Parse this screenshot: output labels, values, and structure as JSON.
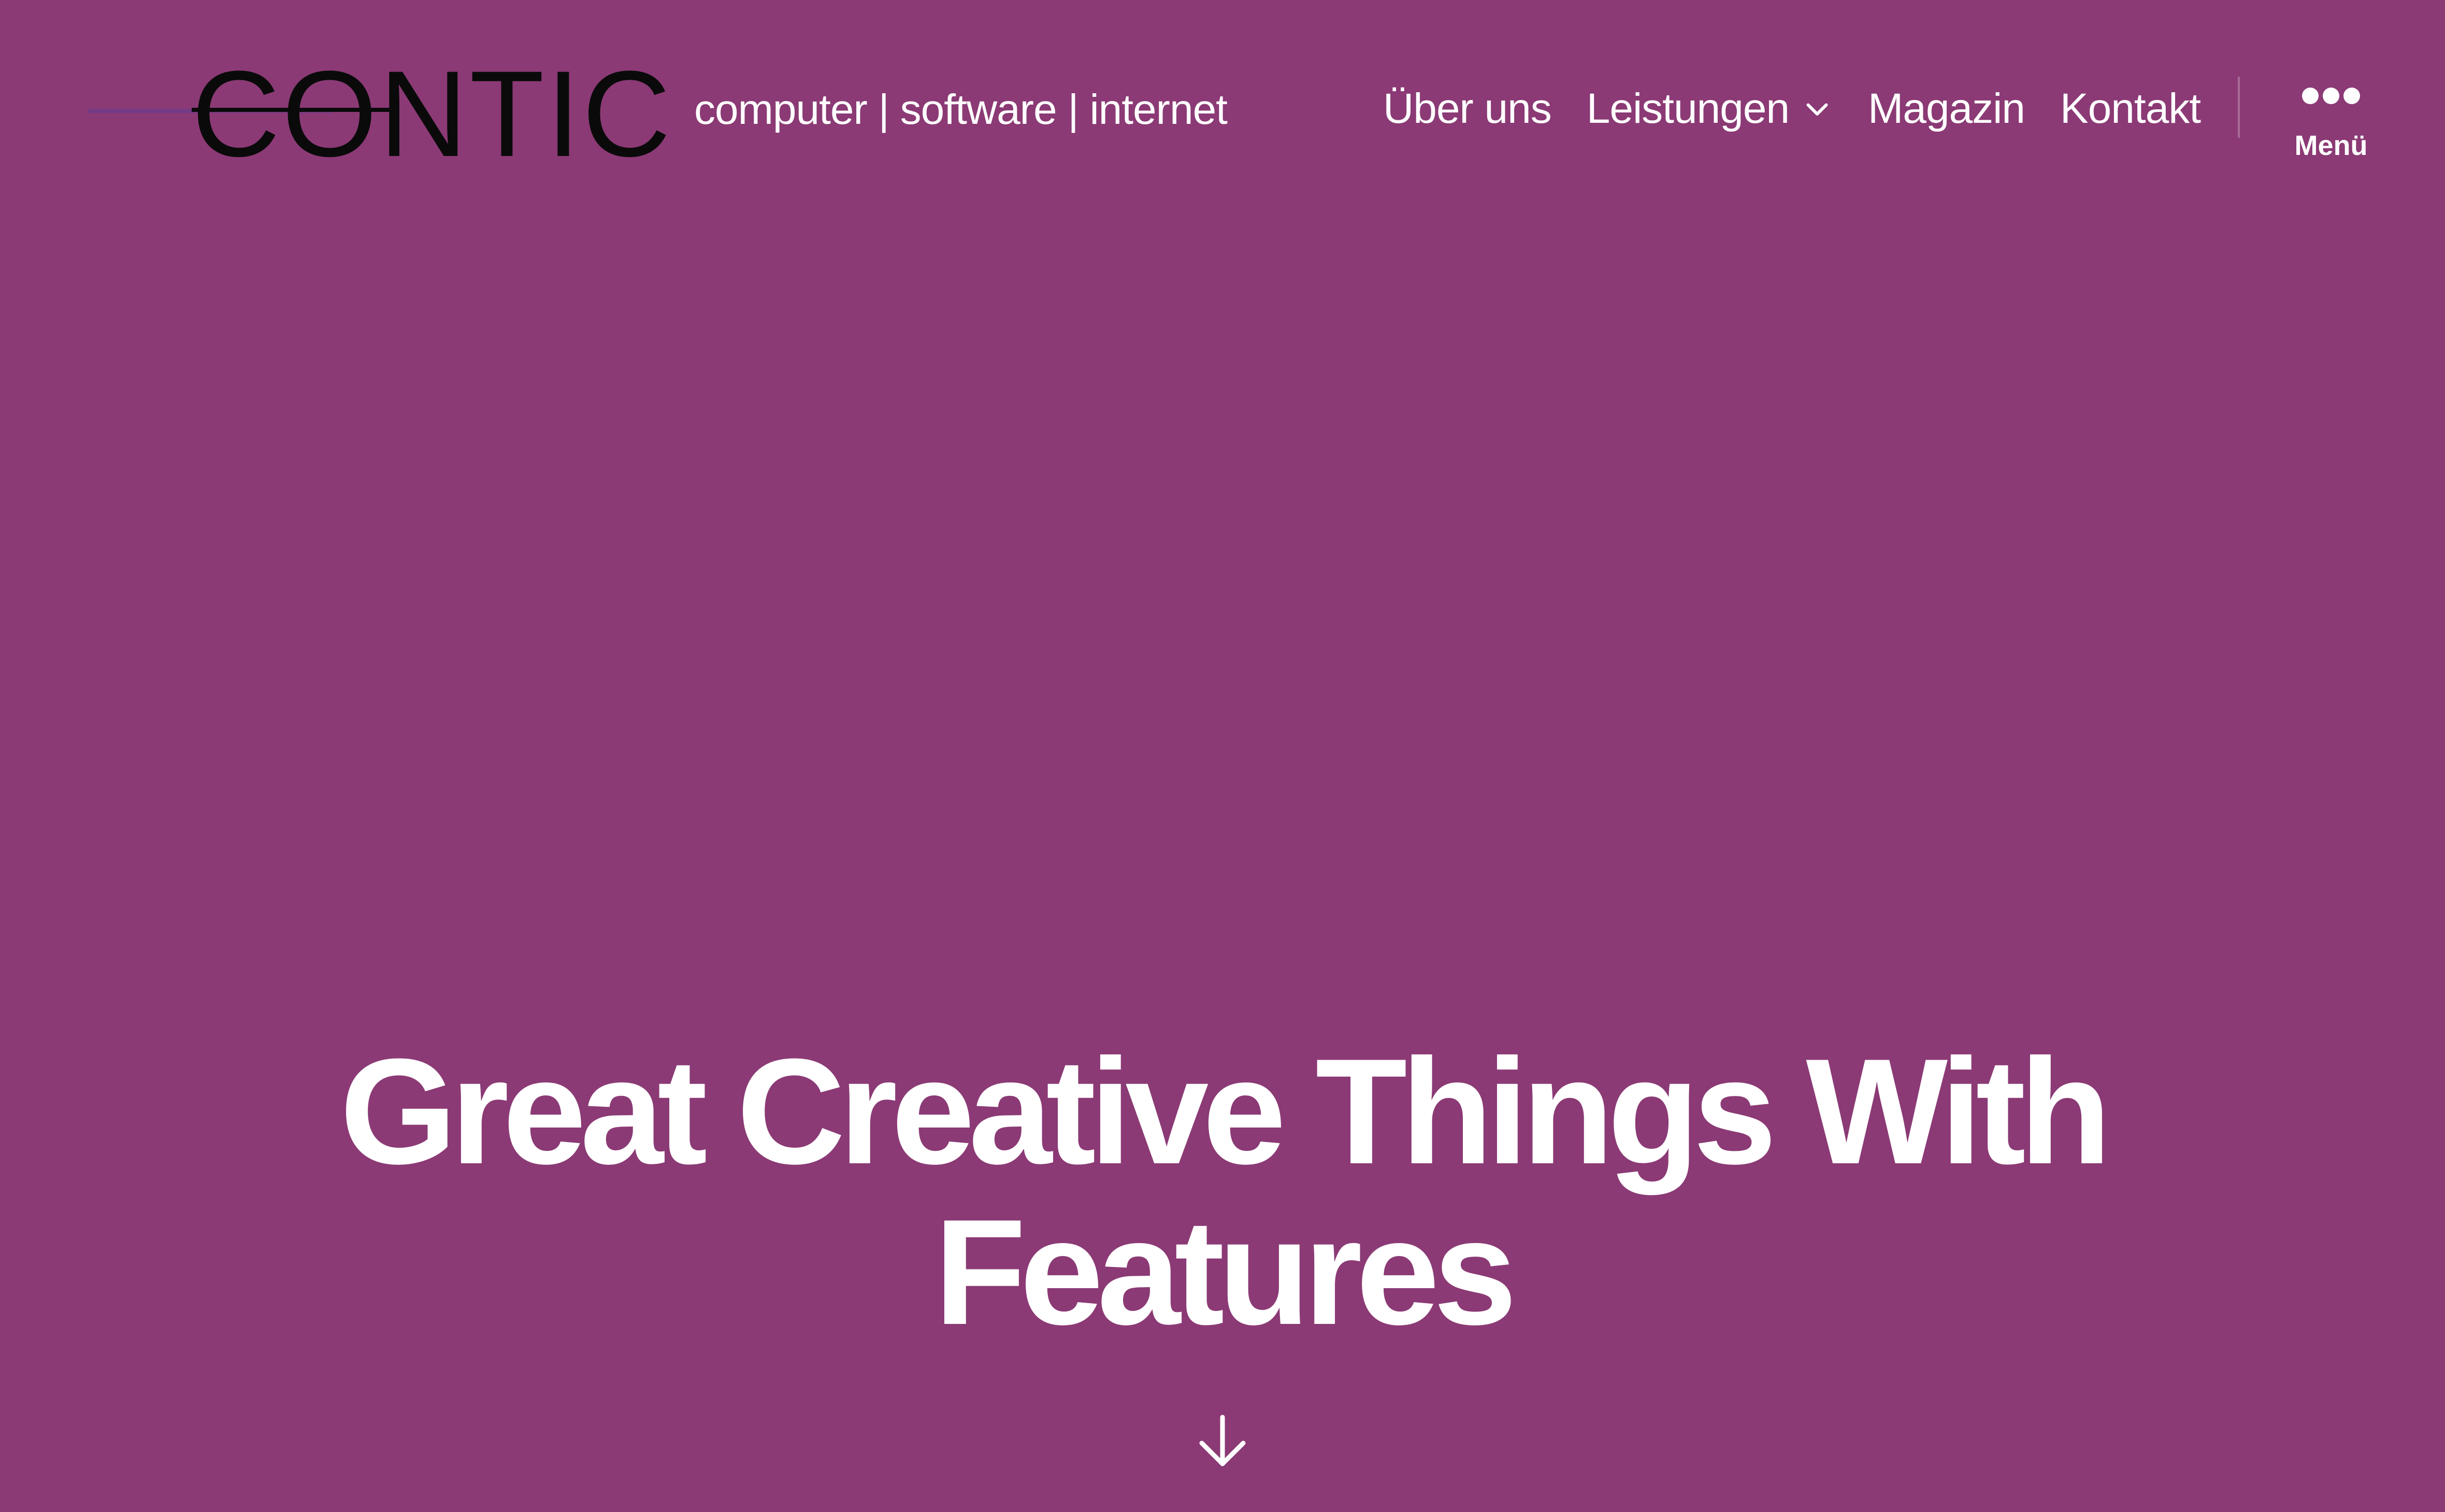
{
  "colors": {
    "background": "#8b3a75",
    "text": "#ffffff",
    "logo": "#0a0a0a",
    "logo_accent": "#6e3c8a"
  },
  "header": {
    "logo_text": "CONTIC",
    "tagline": "computer | software | internet",
    "nav": [
      {
        "label": "Über uns"
      },
      {
        "label": "Leistungen",
        "icon": "chevron-down-icon"
      },
      {
        "label": "Magazin"
      },
      {
        "label": "Kontakt"
      }
    ],
    "menu_toggle": {
      "icon": "dots-icon",
      "label": "Menü"
    }
  },
  "hero": {
    "title_line1": "Great Creative Things With",
    "title_line2": "Features",
    "scroll_icon": "arrow-down-icon"
  }
}
